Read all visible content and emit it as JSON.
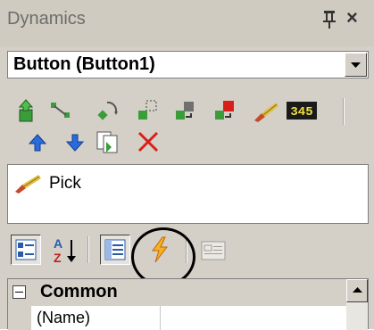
{
  "titlebar": {
    "title": "Dynamics",
    "pin_icon": "pushpin-icon",
    "close_label": "×"
  },
  "object_selector": {
    "value": "Button (Button1)"
  },
  "toolbar": {
    "row1": [
      "add-dynamic-icon",
      "connect-icon",
      "rotate-icon",
      "select-region-icon",
      "move-icon",
      "delete-object-icon",
      "pick-icon",
      "value-display-icon"
    ],
    "value_display_text": "345",
    "row2": [
      "move-up-icon",
      "move-down-icon",
      "copy-icon",
      "delete-icon"
    ]
  },
  "dynamics_list": {
    "items": [
      {
        "label": "Pick",
        "icon": "pick-icon"
      }
    ]
  },
  "property_toolbar": {
    "buttons": [
      "categorized-icon",
      "alphabetical-icon",
      "properties-icon",
      "events-lightning-icon",
      "property-pages-icon"
    ],
    "az_text": "AZ"
  },
  "property_grid": {
    "category": {
      "toggle": "⊟",
      "label": "Common"
    },
    "rows": [
      {
        "name": "(Name)",
        "value": ""
      }
    ]
  },
  "colors": {
    "panel_bg": "#d4d0c8",
    "highlight_ring": "#000000",
    "delete_red": "#d8201a",
    "arrow_blue": "#2a6be0",
    "value_display_bg": "#1a1a1a",
    "value_display_fg": "#f0e040"
  }
}
